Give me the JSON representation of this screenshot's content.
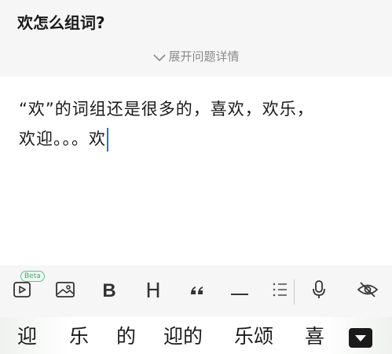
{
  "question": {
    "title": "欢怎么组词?",
    "expand_label": "展开问题详情"
  },
  "editor": {
    "line1": "“欢”的词组还是很多的，喜欢，欢乐，",
    "line2": "欢迎。。。欢"
  },
  "toolbar": {
    "beta_label": "Beta",
    "bold_label": "B",
    "heading_label": "H",
    "quote_label": "“",
    "items": [
      "video-icon",
      "image-icon",
      "bold-button",
      "heading-button",
      "quote-button",
      "divider-button",
      "list-button",
      "microphone-icon",
      "hide-icon"
    ]
  },
  "candidates": {
    "items": [
      "迎",
      "乐",
      "的",
      "迎的",
      "乐颂",
      "喜"
    ]
  },
  "colors": {
    "caret": "#1a73e8",
    "beta_border": "#5fc48c",
    "header_bg": "#f6f6f6"
  }
}
